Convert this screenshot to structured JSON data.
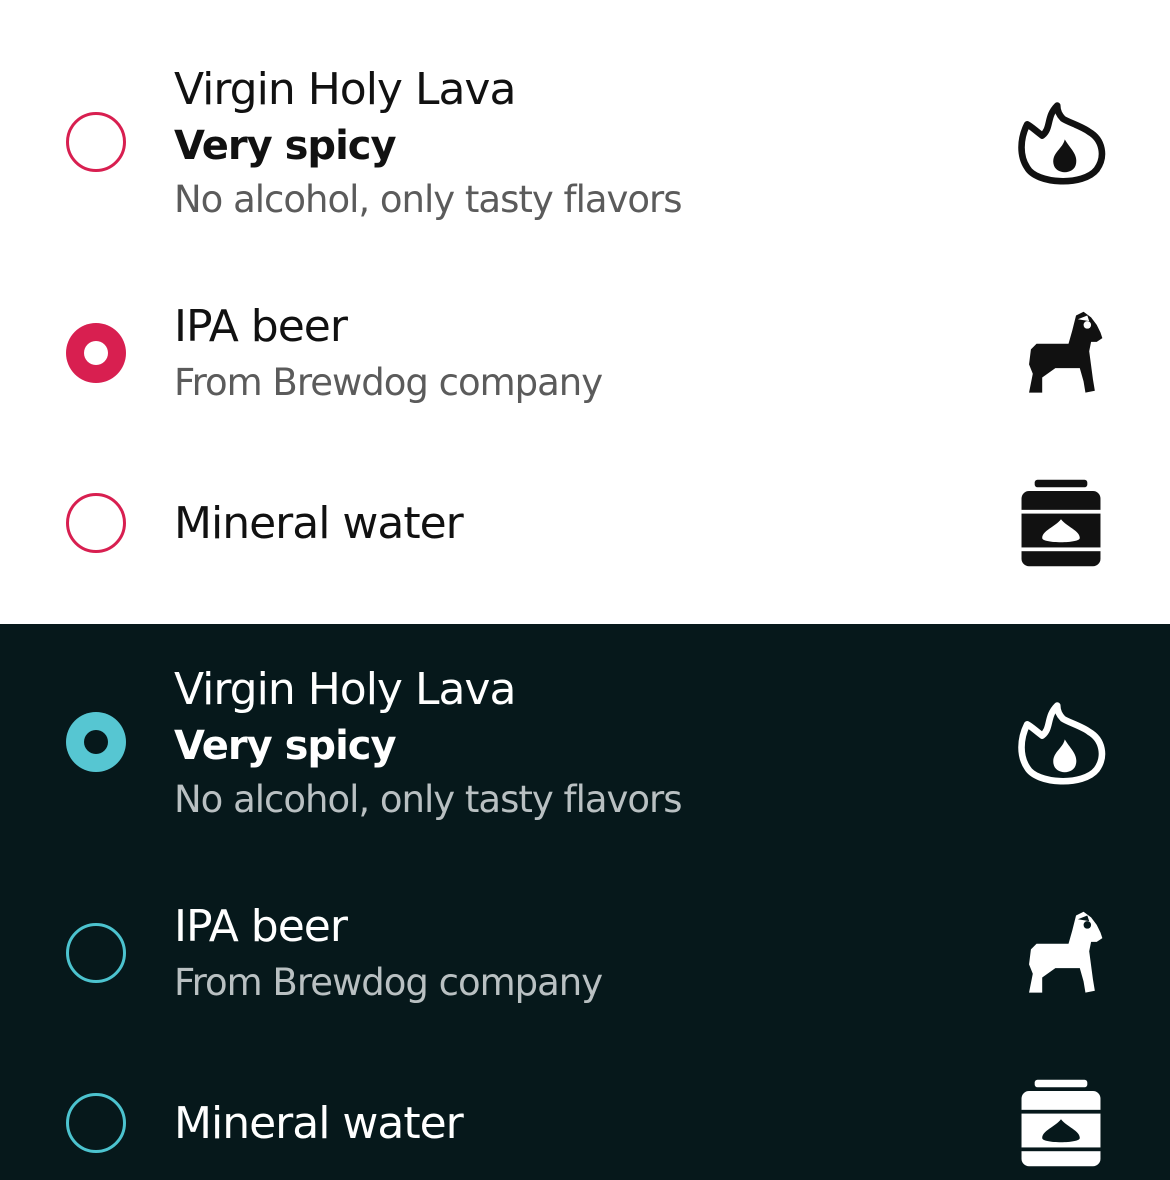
{
  "colors": {
    "light_background": "#ffffff",
    "dark_background": "#06181b",
    "light_accent": "#d81f50",
    "dark_accent": "#56c6d2"
  },
  "light": {
    "items": [
      {
        "title": "Virgin Holy Lava",
        "emphasis": "Very spicy",
        "subtitle": "No alcohol, only tasty flavors",
        "icon": "flame-icon",
        "selected": false
      },
      {
        "title": "IPA beer",
        "subtitle": "From Brewdog company",
        "icon": "dog-icon",
        "selected": true
      },
      {
        "title": "Mineral water",
        "icon": "water-jar-icon",
        "selected": false
      }
    ]
  },
  "dark": {
    "items": [
      {
        "title": "Virgin Holy Lava",
        "emphasis": "Very spicy",
        "subtitle": "No alcohol, only tasty flavors",
        "icon": "flame-icon",
        "selected": true
      },
      {
        "title": "IPA beer",
        "subtitle": "From Brewdog company",
        "icon": "dog-icon",
        "selected": false
      },
      {
        "title": "Mineral water",
        "icon": "water-jar-icon",
        "selected": false
      }
    ]
  }
}
